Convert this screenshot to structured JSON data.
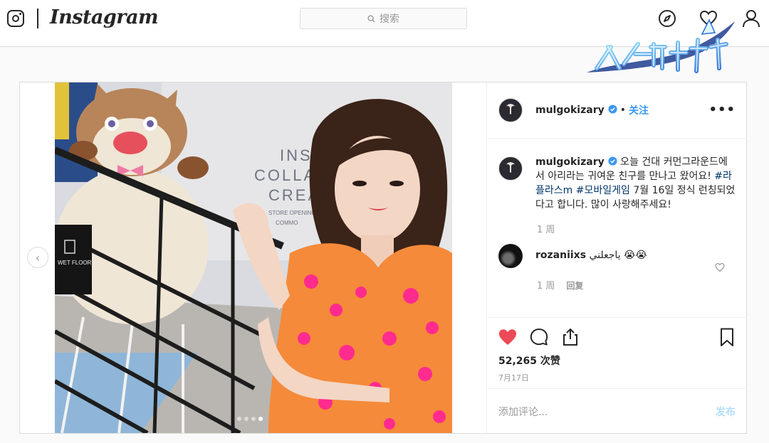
{
  "nav": {
    "brand": "Instagram",
    "search_placeholder": "搜索",
    "icons": [
      "instagram-glyph-icon",
      "search-icon",
      "compass-icon",
      "heart-icon",
      "profile-icon"
    ]
  },
  "watermark": {
    "text": "风之大陆"
  },
  "post": {
    "username": "mulgokizary",
    "follow_label": "关注",
    "separator": "•",
    "more_label": "•••",
    "caption_text": " 오늘 건대 커먼그라운드에서 아리라는 귀여운 친구를 만나고 왔어요! ",
    "hashtag_1": "#라플라스m",
    "hashtag_2": "#모바일게임",
    "caption_tail": " 7월 16일 정식 런칭되었다고 합니다. 많이 사랑해주세요!",
    "caption_time": "1 周",
    "comments": [
      {
        "username": "rozaniixs",
        "text": "ياجعلني 😭😭",
        "time": "1 周",
        "reply_label": "回复"
      }
    ],
    "likes": "52,265 次赞",
    "date": "7月17日",
    "comment_placeholder": "添加评论...",
    "publish_label": "发布",
    "carousel": {
      "total": 4,
      "active_index": 3
    },
    "colors": {
      "like_red": "#ed4956",
      "link_blue": "#3897f0",
      "hashtag": "#003569"
    }
  }
}
